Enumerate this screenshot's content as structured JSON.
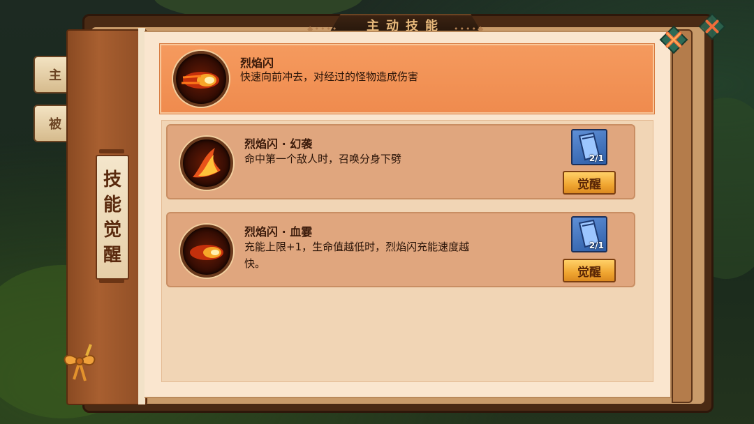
{
  "panel": {
    "title": "主动技能",
    "side_tabs": [
      "主",
      "被"
    ],
    "spine_label": [
      "技",
      "能",
      "觉",
      "醒"
    ]
  },
  "active_skill": {
    "name": "烈焰闪",
    "desc": "快速向前冲去，对经过的怪物造成伤害",
    "icon": "fire-dash-icon"
  },
  "awakenings": [
    {
      "name": "烈焰闪 · 幻袭",
      "desc_lines": [
        "命中第一个敌人时，召唤分身下劈"
      ],
      "icon": "flame-slash-icon",
      "item_icon": "skill-book-icon",
      "item_count": "2/1",
      "button_label": "觉醒"
    },
    {
      "name": "烈焰闪 · 血霎",
      "desc_lines": [
        "充能上限+1，生命值越低时，烈焰闪充能速度越",
        "快。"
      ],
      "icon": "fire-dash-icon",
      "item_icon": "skill-book-icon",
      "item_count": "2/1",
      "button_label": "觉醒"
    }
  ],
  "close_icon": "close-icon",
  "colors": {
    "active_card": "#f59a5e",
    "awake_card": "#e0a67e",
    "button": "#f0a631",
    "spine": "#a85f30"
  }
}
